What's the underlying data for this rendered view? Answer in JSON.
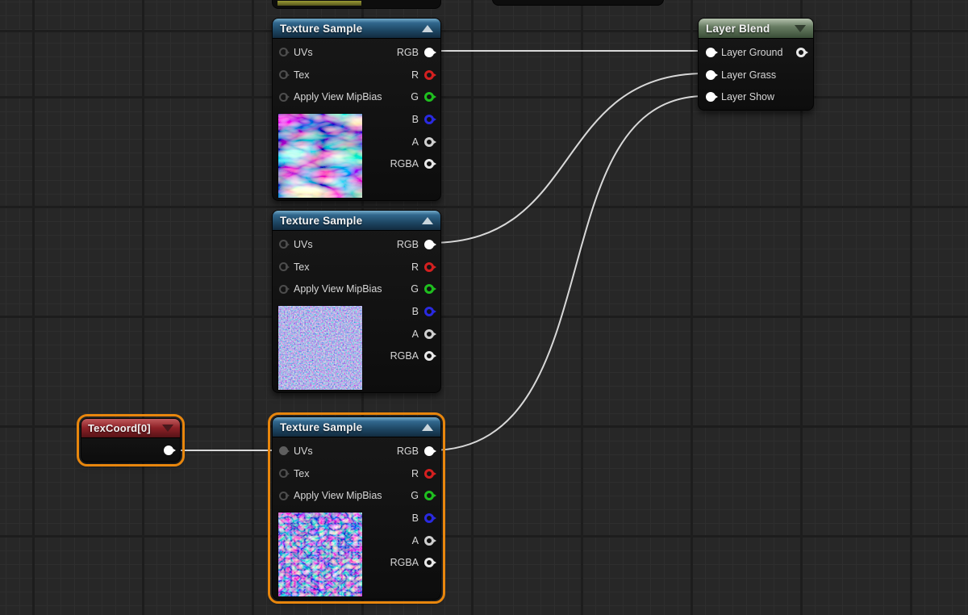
{
  "colors": {
    "background": "#272727",
    "grid_minor": "#2e2e2e",
    "grid_major": "#1d1d1d",
    "wire": "#d8d8d8",
    "selection_outline": "#e8860d",
    "texture_sample_header": "#31678d",
    "layer_blend_header": "#677c62",
    "texcoord_header": "#8e2127",
    "pin_rgb": "#ffffff",
    "pin_r": "#d42020",
    "pin_g": "#1fbf1f",
    "pin_b": "#2a2ae0",
    "pin_a": "#cfcfcf",
    "pin_rgba": "#e8e8e8",
    "pin_input": "#4c4c4c"
  },
  "texture_samples": [
    {
      "title": "Texture Sample",
      "inputs": [
        "UVs",
        "Tex",
        "Apply View MipBias"
      ],
      "outputs": [
        "RGB",
        "R",
        "G",
        "B",
        "A",
        "RGBA"
      ],
      "preview": "blue normal-map texture, wavy ridged pattern",
      "selected": false
    },
    {
      "title": "Texture Sample",
      "inputs": [
        "UVs",
        "Tex",
        "Apply View MipBias"
      ],
      "outputs": [
        "RGB",
        "R",
        "G",
        "B",
        "A",
        "RGBA"
      ],
      "preview": "blue normal-map texture, fine grain noise",
      "selected": false
    },
    {
      "title": "Texture Sample",
      "inputs": [
        "UVs",
        "Tex",
        "Apply View MipBias"
      ],
      "outputs": [
        "RGB",
        "R",
        "G",
        "B",
        "A",
        "RGBA"
      ],
      "preview": "blue normal-map texture, medium grain noise",
      "selected": true
    }
  ],
  "texcoord": {
    "title": "TexCoord[0]",
    "selected": true
  },
  "layer_blend": {
    "title": "Layer Blend",
    "inputs": [
      "Layer Ground",
      "Layer Grass",
      "Layer Show"
    ]
  },
  "wires": [
    "texture-sample-1 RGB -> Layer Blend Layer Ground",
    "texture-sample-2 RGB -> Layer Blend Layer Grass",
    "texture-sample-3 RGB -> Layer Blend Layer Show",
    "texcoord-0 output -> texture-sample-3 UVs"
  ]
}
